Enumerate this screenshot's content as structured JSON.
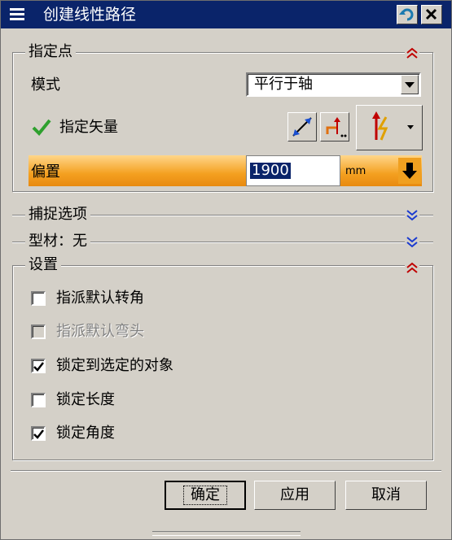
{
  "window": {
    "title": "创建线性路径",
    "colors": {
      "titlebar": "#0a246a",
      "accent_orange": "#f4a020",
      "check_green": "#2ea02e"
    }
  },
  "sections": {
    "specify_point": {
      "title": "指定点",
      "mode_label": "模式",
      "mode_value": "平行于轴",
      "vector_label": "指定矢量",
      "offset_label": "偏置",
      "offset_value": "1900",
      "offset_unit": "mm",
      "expanded": true
    },
    "snap_options": {
      "title": "捕捉选项",
      "expanded": false
    },
    "profile": {
      "title": "型材：无",
      "expanded": false
    },
    "settings": {
      "title": "设置",
      "expanded": true,
      "options": [
        {
          "label": "指派默认转角",
          "checked": false,
          "enabled": true
        },
        {
          "label": "指派默认弯头",
          "checked": false,
          "enabled": false
        },
        {
          "label": "锁定到选定的对象",
          "checked": true,
          "enabled": true
        },
        {
          "label": "锁定长度",
          "checked": false,
          "enabled": true
        },
        {
          "label": "锁定角度",
          "checked": true,
          "enabled": true
        }
      ]
    }
  },
  "buttons": {
    "ok": "确定",
    "apply": "应用",
    "cancel": "取消"
  },
  "icons": [
    "menu-icon",
    "return-icon",
    "close-icon",
    "collapse-icon",
    "expand-icon",
    "checkmark-icon",
    "reverse-direction-icon",
    "vector-constructor-icon",
    "vector-type-icon",
    "dropdown-arrow-icon",
    "unit-down-arrow-icon"
  ]
}
